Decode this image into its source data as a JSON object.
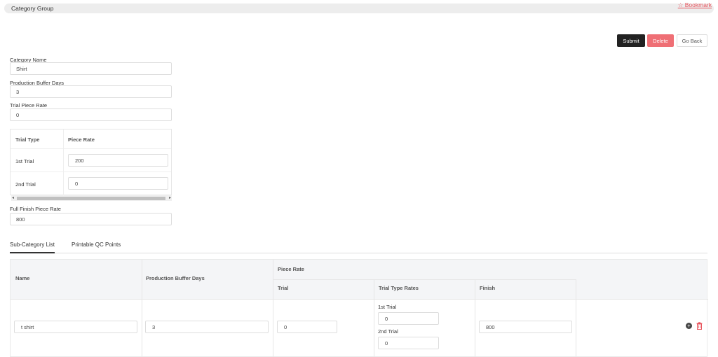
{
  "header": {
    "title": "Category Group",
    "bookmark_label": "Bookmark"
  },
  "actions": {
    "submit": "Submit",
    "delete": "Delete",
    "back": "Go Back"
  },
  "form": {
    "category_name": {
      "label": "Category Name",
      "value": "Shirt"
    },
    "buffer_days": {
      "label": "Production Buffer Days",
      "value": "3"
    },
    "trial_rate": {
      "label": "Trial Piece Rate",
      "value": "0"
    },
    "full_finish": {
      "label": "Full Finish Piece Rate",
      "value": "800"
    }
  },
  "trial_table": {
    "headers": [
      "Trial Type",
      "Piece Rate"
    ],
    "rows": [
      {
        "type": "1st Trial",
        "rate": "200"
      },
      {
        "type": "2nd Trial",
        "rate": "0"
      }
    ]
  },
  "tabs": [
    "Sub-Category List",
    "Printable QC Points"
  ],
  "sub_table": {
    "headers": {
      "name": "Name",
      "buffer": "Production Buffer Days",
      "piece_rate": "Piece Rate",
      "trial": "Trial",
      "trial_type_rates": "Trial Type Rates",
      "finish": "Finish"
    },
    "rows": [
      {
        "name": "t shirt",
        "buffer": "3",
        "trial": "0",
        "trial_1_label": "1st Trial",
        "trial_1_value": "0",
        "trial_2_label": "2nd Trial",
        "trial_2_value": "0",
        "finish": "800"
      }
    ]
  },
  "colors": {
    "accent_delete": "#ef6f75",
    "submit": "#222222",
    "bookmark": "#e8535c"
  }
}
